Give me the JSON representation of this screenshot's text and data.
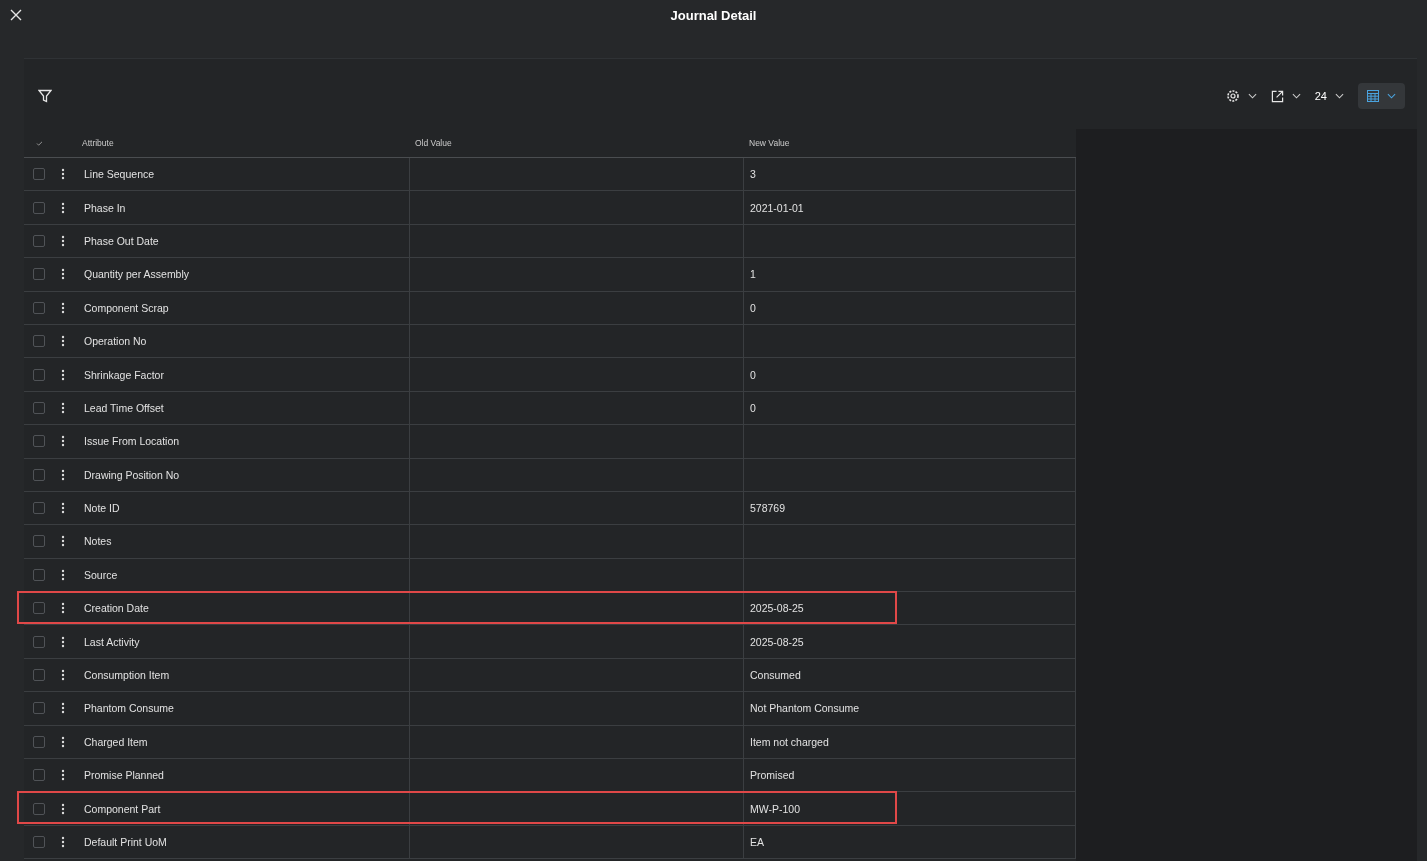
{
  "window": {
    "title": "Journal Detail"
  },
  "toolbar": {
    "page_size": "24"
  },
  "table": {
    "columns": [
      "Attribute",
      "Old Value",
      "New Value"
    ],
    "rows": [
      {
        "attribute": "Line Sequence",
        "old_value": "",
        "new_value": "3",
        "selected": false,
        "highlighted": false
      },
      {
        "attribute": "Phase In",
        "old_value": "",
        "new_value": "2021-01-01",
        "selected": false,
        "highlighted": false
      },
      {
        "attribute": "Phase Out Date",
        "old_value": "",
        "new_value": "",
        "selected": false,
        "highlighted": false
      },
      {
        "attribute": "Quantity per Assembly",
        "old_value": "",
        "new_value": "1",
        "selected": false,
        "highlighted": false
      },
      {
        "attribute": "Component Scrap",
        "old_value": "",
        "new_value": "0",
        "selected": false,
        "highlighted": false
      },
      {
        "attribute": "Operation No",
        "old_value": "",
        "new_value": "",
        "selected": false,
        "highlighted": false
      },
      {
        "attribute": "Shrinkage Factor",
        "old_value": "",
        "new_value": "0",
        "selected": false,
        "highlighted": false
      },
      {
        "attribute": "Lead Time Offset",
        "old_value": "",
        "new_value": "0",
        "selected": false,
        "highlighted": false
      },
      {
        "attribute": "Issue From Location",
        "old_value": "",
        "new_value": "",
        "selected": false,
        "highlighted": false
      },
      {
        "attribute": "Drawing Position No",
        "old_value": "",
        "new_value": "",
        "selected": false,
        "highlighted": false
      },
      {
        "attribute": "Note ID",
        "old_value": "",
        "new_value": "578769",
        "selected": false,
        "highlighted": false
      },
      {
        "attribute": "Notes",
        "old_value": "",
        "new_value": "",
        "selected": false,
        "highlighted": false
      },
      {
        "attribute": "Source",
        "old_value": "",
        "new_value": "",
        "selected": false,
        "highlighted": false
      },
      {
        "attribute": "Creation Date",
        "old_value": "",
        "new_value": "2025-08-25",
        "selected": false,
        "highlighted": true
      },
      {
        "attribute": "Last Activity",
        "old_value": "",
        "new_value": "2025-08-25",
        "selected": false,
        "highlighted": false
      },
      {
        "attribute": "Consumption Item",
        "old_value": "",
        "new_value": "Consumed",
        "selected": false,
        "highlighted": false
      },
      {
        "attribute": "Phantom Consume",
        "old_value": "",
        "new_value": "Not Phantom Consume",
        "selected": false,
        "highlighted": false
      },
      {
        "attribute": "Charged Item",
        "old_value": "",
        "new_value": "Item not charged",
        "selected": false,
        "highlighted": false
      },
      {
        "attribute": "Promise Planned",
        "old_value": "",
        "new_value": "Promised",
        "selected": false,
        "highlighted": false
      },
      {
        "attribute": "Component Part",
        "old_value": "",
        "new_value": "MW-P-100",
        "selected": false,
        "highlighted": true
      },
      {
        "attribute": "Default Print UoM",
        "old_value": "",
        "new_value": "EA",
        "selected": false,
        "highlighted": false
      }
    ]
  }
}
